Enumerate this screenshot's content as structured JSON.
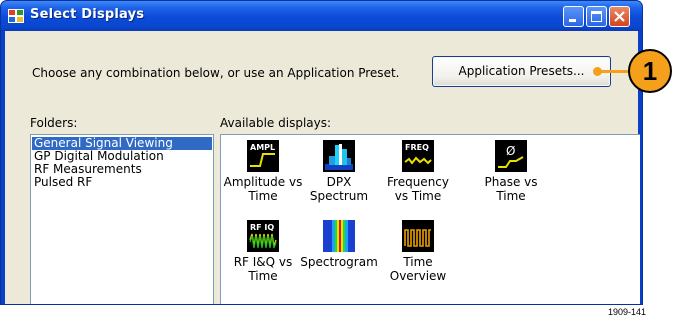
{
  "window": {
    "title": "Select Displays",
    "controls": [
      "minimize-icon",
      "maximize-icon",
      "close-icon"
    ]
  },
  "prompt": "Choose any combination below, or use an Application Preset.",
  "preset_button_label": "Application Presets...",
  "folders": {
    "label": "Folders:",
    "items": [
      "General Signal Viewing",
      "GP Digital Modulation",
      "RF Measurements",
      "Pulsed RF"
    ],
    "selected": "General Signal Viewing"
  },
  "displays": {
    "label": "Available displays:",
    "items": [
      {
        "label": "Amplitude vs\nTime",
        "icon": "amplitude-vs-time-icon",
        "icon_text": "AMPL"
      },
      {
        "label": "DPX\nSpectrum",
        "icon": "dpx-spectrum-icon"
      },
      {
        "label": "Frequency\nvs Time",
        "icon": "frequency-vs-time-icon",
        "icon_text": "FREQ"
      },
      {
        "label": "Phase vs\nTime",
        "icon": "phase-vs-time-icon",
        "icon_text": "Ø"
      },
      {
        "label": "RF I&Q vs\nTime",
        "icon": "rf-iq-vs-time-icon",
        "icon_text": "RF IQ"
      },
      {
        "label": "Spectrogram",
        "icon": "spectrogram-icon"
      },
      {
        "label": "Time\nOverview",
        "icon": "time-overview-icon"
      }
    ]
  },
  "callout": "1",
  "figure_code": "1909-141",
  "colors": {
    "titlebar": "#0a4bd8",
    "dialog_bg": "#ece9d8",
    "selection": "#316ac5",
    "callout": "#f5a01a"
  }
}
